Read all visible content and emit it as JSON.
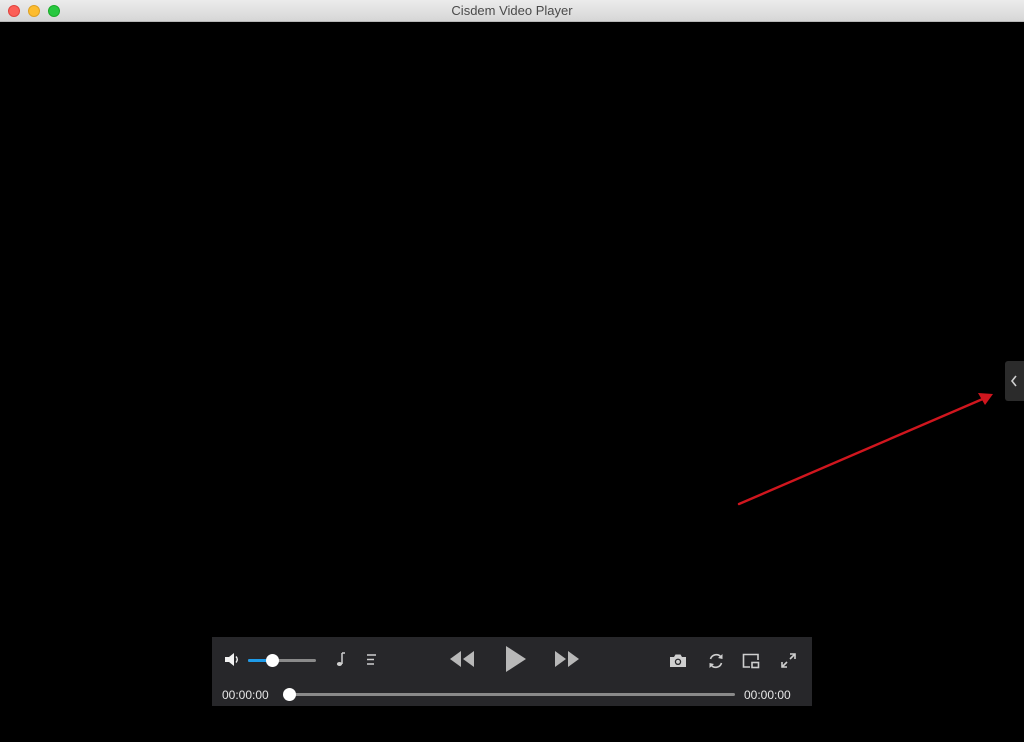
{
  "window": {
    "title": "Cisdem Video Player"
  },
  "icons": {
    "close": "close-button",
    "minimize": "minimize-button",
    "zoom": "zoom-button",
    "sidebar_toggle": "chevron-left-icon",
    "volume": "speaker-icon",
    "audio_track": "music-note-icon",
    "playlist": "list-icon",
    "rewind": "rewind-icon",
    "play": "play-icon",
    "fast_forward": "fast-forward-icon",
    "snapshot": "camera-icon",
    "loop": "loop-icon",
    "pip": "picture-in-picture-icon",
    "fullscreen": "fullscreen-icon"
  },
  "player": {
    "current_time": "00:00:00",
    "duration": "00:00:00",
    "volume_fraction": 0.35,
    "progress_fraction": 0.0
  },
  "annotation": {
    "arrow_color": "#d0161e"
  },
  "colors": {
    "accent": "#1e9be9",
    "control_bar": "#27272a"
  }
}
